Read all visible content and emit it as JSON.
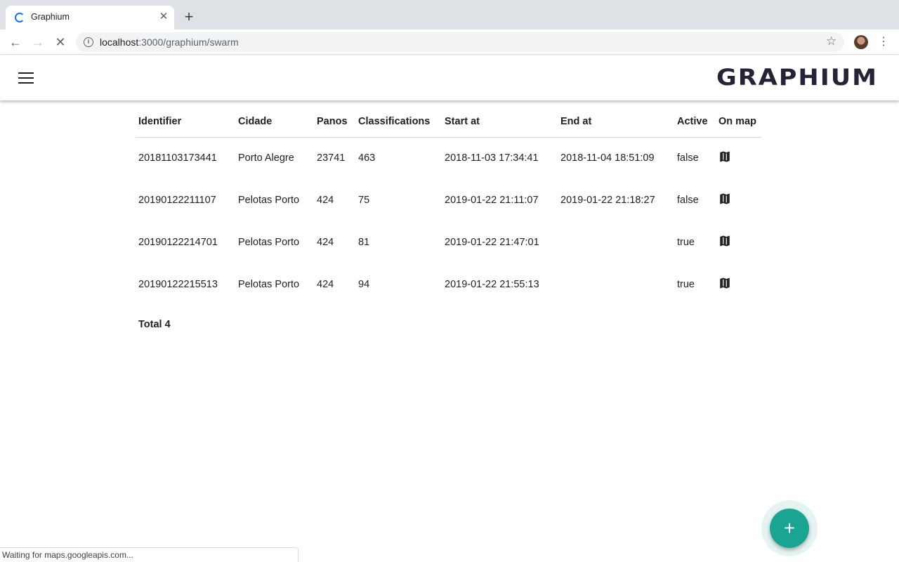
{
  "browser": {
    "tab_title": "Graphium",
    "url_host": "localhost",
    "url_rest": ":3000/graphium/swarm",
    "status_text": "Waiting for maps.googleapis.com..."
  },
  "app": {
    "logo_text": "GRAPHIUM"
  },
  "table": {
    "headers": {
      "identifier": "Identifier",
      "cidade": "Cidade",
      "panos": "Panos",
      "classifications": "Classifications",
      "start_at": "Start at",
      "end_at": "End at",
      "active": "Active",
      "on_map": "On map"
    },
    "rows": [
      {
        "identifier": "20181103173441",
        "cidade": "Porto Alegre",
        "panos": "23741",
        "classifications": "463",
        "start_at": "2018-11-03 17:34:41",
        "end_at": "2018-11-04 18:51:09",
        "active": "false"
      },
      {
        "identifier": "20190122211107",
        "cidade": "Pelotas Porto",
        "panos": "424",
        "classifications": "75",
        "start_at": "2019-01-22 21:11:07",
        "end_at": "2019-01-22 21:18:27",
        "active": "false"
      },
      {
        "identifier": "20190122214701",
        "cidade": "Pelotas Porto",
        "panos": "424",
        "classifications": "81",
        "start_at": "2019-01-22 21:47:01",
        "end_at": "",
        "active": "true"
      },
      {
        "identifier": "20190122215513",
        "cidade": "Pelotas Porto",
        "panos": "424",
        "classifications": "94",
        "start_at": "2019-01-22 21:55:13",
        "end_at": "",
        "active": "true"
      }
    ],
    "total_text": "Total 4"
  },
  "icons": {
    "map": "map-icon",
    "add": "plus-icon"
  },
  "colors": {
    "fab": "#1aa592",
    "logo": "#272236",
    "spinner": "#1a73e8"
  }
}
